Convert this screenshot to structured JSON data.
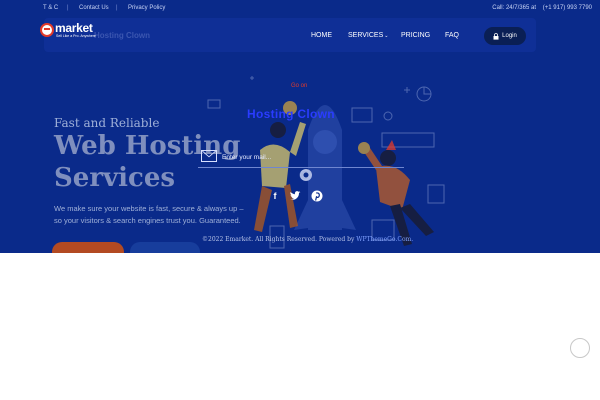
{
  "topbar": {
    "links": [
      "T & C",
      "Contact Us",
      "Privacy Policy"
    ],
    "separator": "|",
    "call_label": "Call: 24/7/365 at",
    "phone": "(+1 917) 993 7790"
  },
  "logo": {
    "word": "market",
    "tagline": "Sell Like a Pro. Anywhere"
  },
  "brand_ghost": "Hosting Clown",
  "nav": {
    "items": [
      "HOME",
      "SERVICES",
      "PRICING",
      "FAQ"
    ],
    "services_chevron": "⌄",
    "login": "Login"
  },
  "hero": {
    "kicker": "Fast and Reliable",
    "title_line1": "Web Hosting",
    "title_line2": "Services",
    "desc_line1": "We make sure your website is fast, secure & always up –",
    "desc_line2": "so your visitors & search engines trust you. Guaranteed."
  },
  "overlay": {
    "go_on": "Go on",
    "brand": "Hosting Clown",
    "email_placeholder": "Enter your mail...",
    "social": [
      "facebook",
      "twitter",
      "pinterest"
    ],
    "copyright_prefix": "©2022 Emarket. All Rights Reserved. Powered by ",
    "copyright_link": "WPThemeGo.Com."
  },
  "colors": {
    "hero_bg": "#0a2a8a",
    "accent_orange": "#b34a22",
    "logo_red": "#e23a2a",
    "overlay_brand": "#2a3cff"
  },
  "icons": [
    "lock-icon",
    "mail-icon",
    "facebook-icon",
    "twitter-icon",
    "pinterest-icon",
    "scroll-top-icon"
  ]
}
